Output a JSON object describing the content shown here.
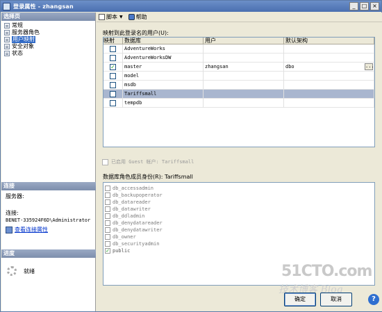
{
  "window": {
    "title": "登录属性 - zhangsan",
    "min_label": "_",
    "max_label": "□",
    "close_label": "×"
  },
  "left": {
    "select_page_header": "选择页",
    "pages": [
      {
        "label": "常规",
        "selected": false
      },
      {
        "label": "服务器角色",
        "selected": false
      },
      {
        "label": "用户映射",
        "selected": true
      },
      {
        "label": "安全对象",
        "selected": false
      },
      {
        "label": "状态",
        "selected": false
      }
    ],
    "connection_header": "连接",
    "server_label": "服务器:",
    "server_value": "",
    "connection_label": "连接:",
    "connection_value": "BENET-335924F6D\\Administrator",
    "view_link": "查看连接属性",
    "progress_header": "进度",
    "progress_status": "就绪"
  },
  "toolbar": {
    "script_label": "脚本",
    "help_label": "帮助"
  },
  "mapping": {
    "label": "映射到此登录名的用户(U):",
    "columns": [
      "映射",
      "数据库",
      "用户",
      "默认架构"
    ],
    "rows": [
      {
        "mapped": false,
        "database": "AdventureWorks",
        "user": "",
        "schema": "",
        "selected": false
      },
      {
        "mapped": false,
        "database": "AdventureWorksDW",
        "user": "",
        "schema": "",
        "selected": false
      },
      {
        "mapped": true,
        "database": "master",
        "user": "zhangsan",
        "schema": "dbo",
        "selected": false
      },
      {
        "mapped": false,
        "database": "model",
        "user": "",
        "schema": "",
        "selected": false
      },
      {
        "mapped": false,
        "database": "msdb",
        "user": "",
        "schema": "",
        "selected": false
      },
      {
        "mapped": false,
        "database": "Tariffsmall",
        "user": "",
        "schema": "",
        "selected": true
      },
      {
        "mapped": false,
        "database": "tempdb",
        "user": "",
        "schema": "",
        "selected": false
      }
    ],
    "ellipsis_label": "..."
  },
  "guest": {
    "label": "已启用 Guest 帐户: Tariffsmall"
  },
  "roles": {
    "label": "数据库角色成员身份(R): Tariffsmall",
    "items": [
      {
        "name": "db_accessadmin",
        "checked": false
      },
      {
        "name": "db_backupoperator",
        "checked": false
      },
      {
        "name": "db_datareader",
        "checked": false
      },
      {
        "name": "db_datawriter",
        "checked": false
      },
      {
        "name": "db_ddladmin",
        "checked": false
      },
      {
        "name": "db_denydatareader",
        "checked": false
      },
      {
        "name": "db_denydatawriter",
        "checked": false
      },
      {
        "name": "db_owner",
        "checked": false
      },
      {
        "name": "db_securityadmin",
        "checked": false
      },
      {
        "name": "public",
        "checked": true
      }
    ]
  },
  "footer": {
    "ok_label": "确定",
    "cancel_label": "取消",
    "help_symbol": "?"
  },
  "watermark": {
    "line1": "51CTO.com",
    "line2": "技术博客 Blog"
  },
  "icons": {
    "app": "login-properties-icon",
    "page": "page-icon",
    "link": "connection-properties-icon",
    "spinner": "progress-spinner-icon",
    "script": "script-icon",
    "help": "help-icon"
  },
  "colors": {
    "title_bar": "#4a6fb0",
    "selection": "#316ac5",
    "selected_row": "#a9b6cf",
    "link": "#0033cc",
    "check": "#21a121"
  }
}
